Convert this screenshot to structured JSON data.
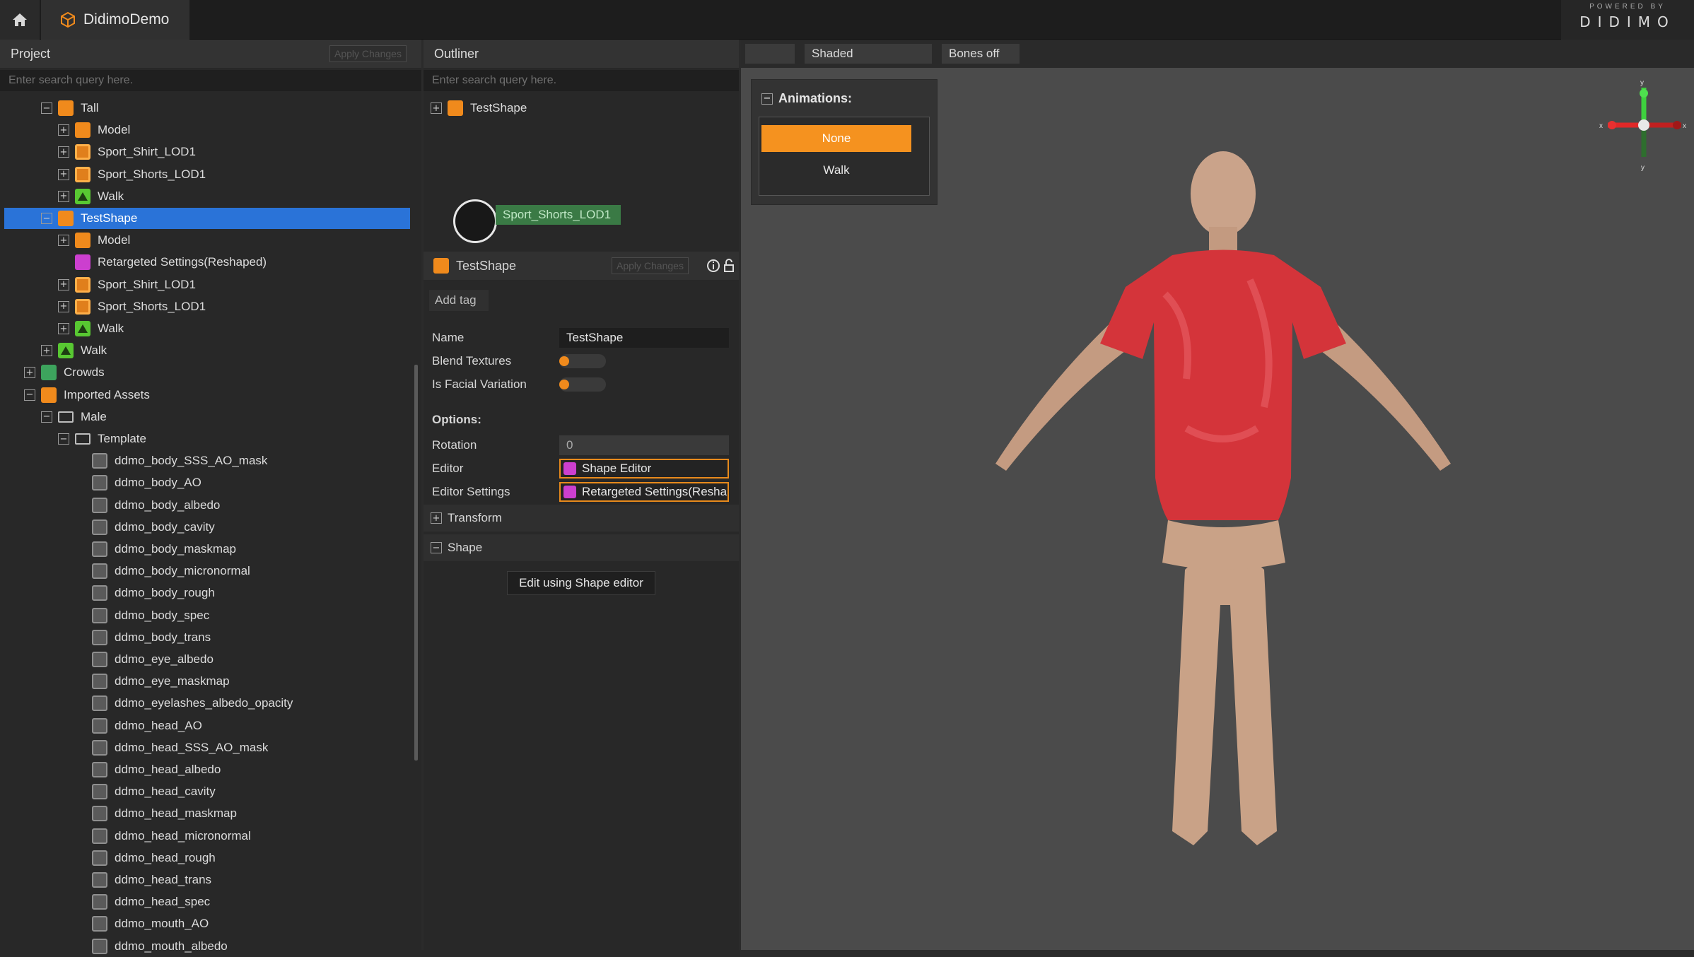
{
  "app": {
    "title": "DidimoDemo"
  },
  "brand": {
    "powered": "POWERED BY",
    "logo": "DIDIMO"
  },
  "project": {
    "title": "Project",
    "apply_label": "Apply Changes",
    "search_placeholder": "Enter search query here.",
    "tree": [
      {
        "label": "Tall",
        "toggle": "−",
        "icon": "orange",
        "depth": 2
      },
      {
        "label": "Model",
        "toggle": "+",
        "icon": "orange",
        "depth": 3
      },
      {
        "label": "Sport_Shirt_LOD1",
        "toggle": "+",
        "icon": "box",
        "depth": 3
      },
      {
        "label": "Sport_Shorts_LOD1",
        "toggle": "+",
        "icon": "box",
        "depth": 3
      },
      {
        "label": "Walk",
        "toggle": "+",
        "icon": "green",
        "depth": 3
      },
      {
        "label": "TestShape",
        "toggle": "−",
        "icon": "orange",
        "depth": 2,
        "selected": true
      },
      {
        "label": "Model",
        "toggle": "+",
        "icon": "orange",
        "depth": 3
      },
      {
        "label": "Retargeted Settings(Reshaped)",
        "toggle": "",
        "icon": "mag",
        "depth": 3
      },
      {
        "label": "Sport_Shirt_LOD1",
        "toggle": "+",
        "icon": "box",
        "depth": 3
      },
      {
        "label": "Sport_Shorts_LOD1",
        "toggle": "+",
        "icon": "box",
        "depth": 3
      },
      {
        "label": "Walk",
        "toggle": "+",
        "icon": "green",
        "depth": 3
      },
      {
        "label": "Walk",
        "toggle": "+",
        "icon": "green",
        "depth": 2
      },
      {
        "label": "Crowds",
        "toggle": "+",
        "icon": "crowd",
        "depth": 1
      },
      {
        "label": "Imported Assets",
        "toggle": "−",
        "icon": "orange",
        "depth": 1
      },
      {
        "label": "Male",
        "toggle": "−",
        "icon": "folder",
        "depth": 2
      },
      {
        "label": "Template",
        "toggle": "−",
        "icon": "folder",
        "depth": 3
      },
      {
        "label": "ddmo_body_SSS_AO_mask",
        "toggle": "",
        "icon": "tex",
        "depth": 4
      },
      {
        "label": "ddmo_body_AO",
        "toggle": "",
        "icon": "tex",
        "depth": 4
      },
      {
        "label": "ddmo_body_albedo",
        "toggle": "",
        "icon": "tex",
        "depth": 4
      },
      {
        "label": "ddmo_body_cavity",
        "toggle": "",
        "icon": "tex",
        "depth": 4
      },
      {
        "label": "ddmo_body_maskmap",
        "toggle": "",
        "icon": "tex",
        "depth": 4
      },
      {
        "label": "ddmo_body_micronormal",
        "toggle": "",
        "icon": "tex",
        "depth": 4
      },
      {
        "label": "ddmo_body_rough",
        "toggle": "",
        "icon": "tex",
        "depth": 4
      },
      {
        "label": "ddmo_body_spec",
        "toggle": "",
        "icon": "tex",
        "depth": 4
      },
      {
        "label": "ddmo_body_trans",
        "toggle": "",
        "icon": "tex",
        "depth": 4
      },
      {
        "label": "ddmo_eye_albedo",
        "toggle": "",
        "icon": "tex",
        "depth": 4
      },
      {
        "label": "ddmo_eye_maskmap",
        "toggle": "",
        "icon": "tex",
        "depth": 4
      },
      {
        "label": "ddmo_eyelashes_albedo_opacity",
        "toggle": "",
        "icon": "tex",
        "depth": 4
      },
      {
        "label": "ddmo_head_AO",
        "toggle": "",
        "icon": "tex",
        "depth": 4
      },
      {
        "label": "ddmo_head_SSS_AO_mask",
        "toggle": "",
        "icon": "tex",
        "depth": 4
      },
      {
        "label": "ddmo_head_albedo",
        "toggle": "",
        "icon": "tex",
        "depth": 4
      },
      {
        "label": "ddmo_head_cavity",
        "toggle": "",
        "icon": "tex",
        "depth": 4
      },
      {
        "label": "ddmo_head_maskmap",
        "toggle": "",
        "icon": "tex",
        "depth": 4
      },
      {
        "label": "ddmo_head_micronormal",
        "toggle": "",
        "icon": "tex",
        "depth": 4
      },
      {
        "label": "ddmo_head_rough",
        "toggle": "",
        "icon": "tex",
        "depth": 4
      },
      {
        "label": "ddmo_head_trans",
        "toggle": "",
        "icon": "tex",
        "depth": 4
      },
      {
        "label": "ddmo_head_spec",
        "toggle": "",
        "icon": "tex",
        "depth": 4
      },
      {
        "label": "ddmo_mouth_AO",
        "toggle": "",
        "icon": "tex",
        "depth": 4
      },
      {
        "label": "ddmo_mouth_albedo",
        "toggle": "",
        "icon": "tex",
        "depth": 4
      }
    ]
  },
  "outliner": {
    "title": "Outliner",
    "search_placeholder": "Enter search query here.",
    "root_label": "TestShape",
    "drag_label": "Sport_Shorts_LOD1"
  },
  "inspector": {
    "title": "TestShape",
    "apply_label": "Apply Changes",
    "add_tag": "Add tag",
    "name_label": "Name",
    "name_value": "TestShape",
    "blend_label": "Blend Textures",
    "facial_label": "Is Facial Variation",
    "options_label": "Options:",
    "rotation_label": "Rotation",
    "rotation_value": "0",
    "editor_label": "Editor",
    "editor_value": "Shape Editor",
    "settings_label": "Editor Settings",
    "settings_value": "Retargeted Settings(Resha",
    "transform_label": "Transform",
    "shape_label": "Shape",
    "edit_button": "Edit using Shape editor"
  },
  "viewport": {
    "blank_button": "",
    "shading": "Shaded",
    "bones": "Bones off",
    "animations_title": "Animations:",
    "anim_none": "None",
    "anim_walk": "Walk",
    "gizmo": {
      "x": "x",
      "y": "y"
    }
  },
  "colors": {
    "accent": "#f5921f",
    "selection": "#2a73d8"
  }
}
